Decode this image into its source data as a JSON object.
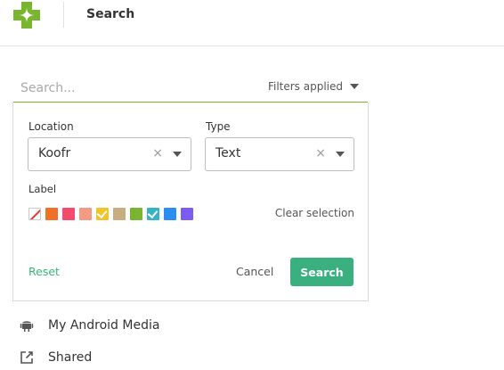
{
  "header": {
    "title": "Search",
    "brand_color": "#7ab532"
  },
  "search": {
    "placeholder": "Search...",
    "value": "",
    "filters_label": "Filters applied"
  },
  "filters": {
    "location": {
      "label": "Location",
      "value": "Koofr",
      "clear_glyph": "×"
    },
    "type": {
      "label": "Type",
      "value": "Text",
      "clear_glyph": "×"
    },
    "label": {
      "label": "Label",
      "colors": [
        {
          "name": "none",
          "color": "#ffffff",
          "checked": false
        },
        {
          "name": "orange",
          "color": "#f07124",
          "checked": false
        },
        {
          "name": "pink",
          "color": "#f04c70",
          "checked": false
        },
        {
          "name": "salmon",
          "color": "#f49b84",
          "checked": false
        },
        {
          "name": "yellow",
          "color": "#f2c42b",
          "checked": true
        },
        {
          "name": "tan",
          "color": "#c7ad7f",
          "checked": false
        },
        {
          "name": "green",
          "color": "#7ab532",
          "checked": false
        },
        {
          "name": "teal",
          "color": "#36b4c7",
          "checked": true
        },
        {
          "name": "blue",
          "color": "#2a8df2",
          "checked": false
        },
        {
          "name": "purple",
          "color": "#7b5cf0",
          "checked": false
        }
      ],
      "clear_label": "Clear selection"
    },
    "actions": {
      "reset_label": "Reset",
      "cancel_label": "Cancel",
      "search_label": "Search",
      "search_color": "#3aaf7f"
    }
  },
  "places": [
    {
      "icon": "android-icon",
      "label": "My Android Media"
    },
    {
      "icon": "share-icon",
      "label": "Shared"
    }
  ]
}
